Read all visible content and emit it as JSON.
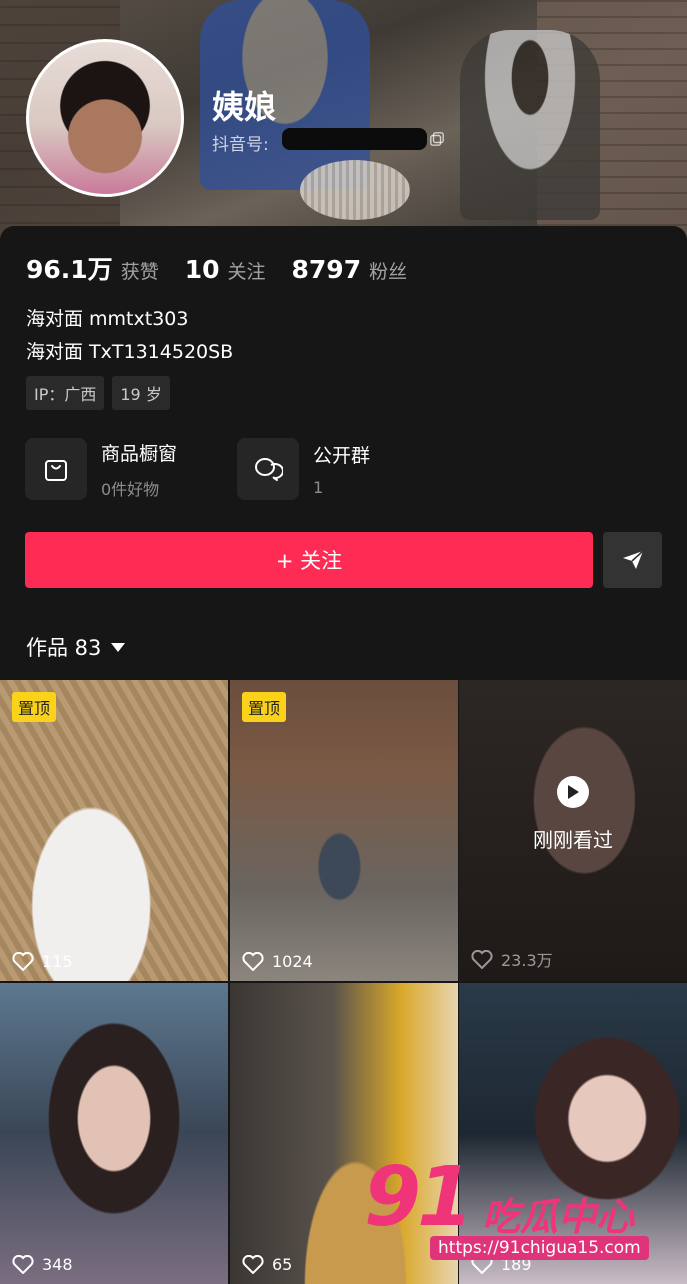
{
  "profile": {
    "name": "姨娘",
    "douyin_id_label": "抖音号:",
    "stats": [
      {
        "num": "96.1万",
        "label": "获赞"
      },
      {
        "num": "10",
        "label": "关注"
      },
      {
        "num": "8797",
        "label": "粉丝"
      }
    ],
    "bio": [
      "海对面 mmtxt303",
      "海对面 TxT1314520SB"
    ],
    "tags": [
      "IP：广西",
      "19 岁"
    ],
    "features": [
      {
        "title": "商品橱窗",
        "sub": "0件好物",
        "icon": "shopping-bag-icon"
      },
      {
        "title": "公开群",
        "sub": "1",
        "icon": "chat-bubbles-icon"
      }
    ],
    "follow_label": "+ 关注"
  },
  "works": {
    "label": "作品 83",
    "items": [
      {
        "badge": "置顶",
        "likes": "115"
      },
      {
        "badge": "置顶",
        "likes": "1024"
      },
      {
        "likes": "23.3万",
        "overlay": "刚刚看过"
      },
      {
        "likes": "348"
      },
      {
        "likes": "65"
      },
      {
        "likes": "189"
      }
    ]
  },
  "watermark": {
    "number": "91",
    "text": "吃瓜中心",
    "url": "https://91chigua15.com"
  },
  "colors": {
    "accent": "#fe2c55",
    "pin_badge": "#fbd21a",
    "watermark": "#f0347a"
  }
}
